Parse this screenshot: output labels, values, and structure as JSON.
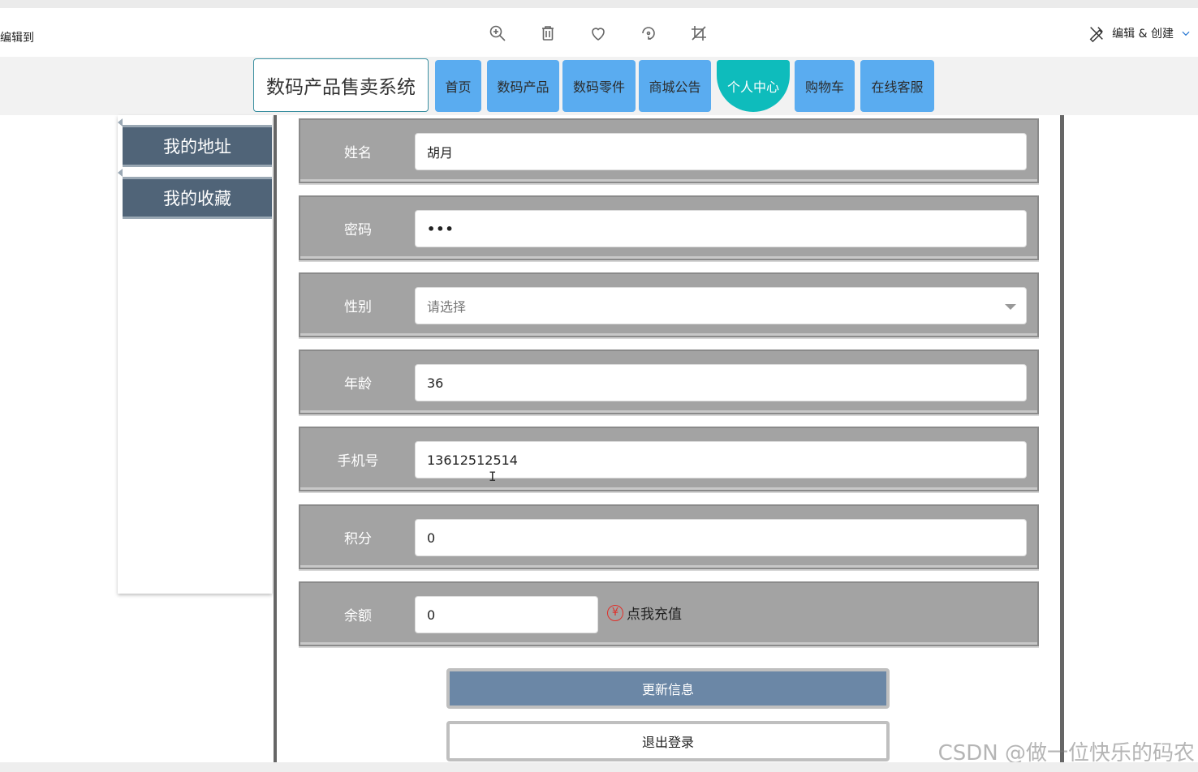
{
  "viewer": {
    "left_text": "编辑到",
    "icons": [
      "zoom-in-icon",
      "trash-icon",
      "heart-icon",
      "rotate-icon",
      "crop-icon"
    ],
    "edit_label": "编辑 & 创建"
  },
  "nav": {
    "brand": "数码产品售卖系统",
    "items": [
      {
        "label": "首页"
      },
      {
        "label": "数码产品"
      },
      {
        "label": "数码零件"
      },
      {
        "label": "商城公告"
      },
      {
        "label": "个人中心",
        "active": true
      },
      {
        "label": "购物车"
      },
      {
        "label": "在线客服"
      }
    ],
    "colors": {
      "item": "#5aacf0",
      "active": "#0ebcbc"
    }
  },
  "sidebar": {
    "items": [
      {
        "label": "我的地址"
      },
      {
        "label": "我的收藏"
      }
    ]
  },
  "form": {
    "name": {
      "label": "姓名",
      "value": "胡月"
    },
    "password": {
      "label": "密码",
      "value": "•••"
    },
    "gender": {
      "label": "性别",
      "placeholder": "请选择"
    },
    "age": {
      "label": "年龄",
      "value": "36"
    },
    "phone": {
      "label": "手机号",
      "value": "13612512514"
    },
    "points": {
      "label": "积分",
      "value": "0"
    },
    "balance": {
      "label": "余额",
      "value": "0",
      "recharge_icon": "¥",
      "recharge": "点我充值"
    }
  },
  "buttons": {
    "update": "更新信息",
    "logout": "退出登录"
  },
  "watermark": "CSDN @做一位快乐的码农"
}
